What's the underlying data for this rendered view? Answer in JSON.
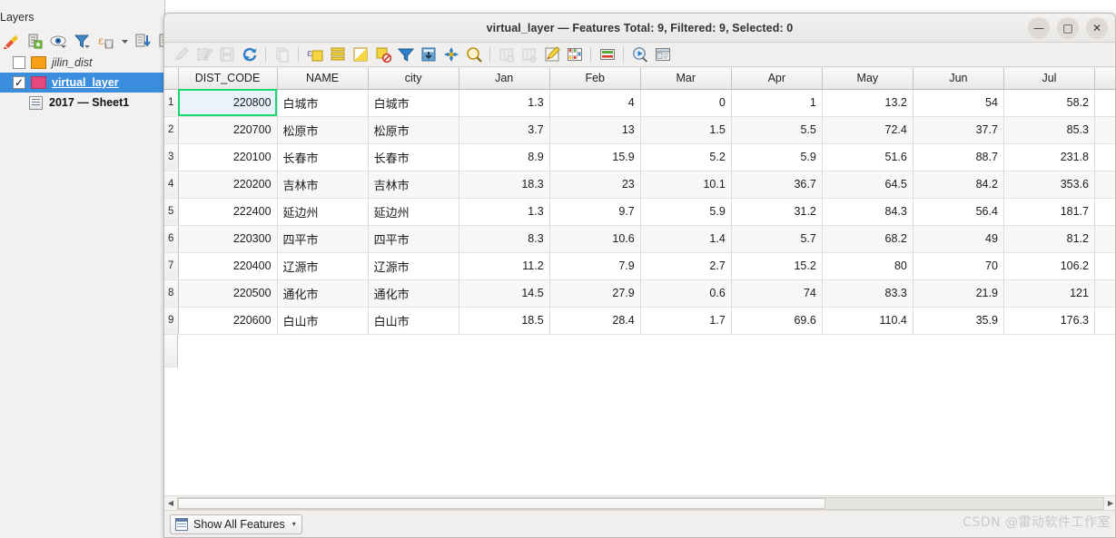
{
  "layers_panel": {
    "title": "Layers",
    "toolbar_icons": [
      "styling-brush-icon",
      "add-group-icon",
      "manage-visibility-icon",
      "filter-legend-icon",
      "expression-filter-icon",
      "filter-dropdown-caret-icon",
      "expand-all-icon",
      "collapse-all-icon"
    ],
    "items": [
      {
        "label": "jilin_dist",
        "checked": false,
        "swatch": "#f5a016",
        "kind": "polygon",
        "selected": false
      },
      {
        "label": "virtual_layer",
        "checked": true,
        "swatch": "#e5487f",
        "kind": "polygon",
        "selected": true
      },
      {
        "label": "2017 — Sheet1",
        "checked": null,
        "swatch": "",
        "kind": "table",
        "selected": false
      }
    ]
  },
  "window": {
    "title": "virtual_layer — Features Total: 9, Filtered: 9, Selected: 0",
    "controls": {
      "minimize": "—",
      "maximize": "□",
      "close": "✕"
    }
  },
  "toolbar": {
    "icons": [
      {
        "name": "toggle-editing-icon",
        "glyph": "pencil",
        "disabled": true
      },
      {
        "name": "multi-edit-icon",
        "glyph": "multiedit",
        "disabled": true
      },
      {
        "name": "save-edits-icon",
        "glyph": "save",
        "disabled": true
      },
      {
        "name": "reload-table-icon",
        "glyph": "reload",
        "disabled": false
      },
      {
        "name": "separator-1",
        "glyph": "sep",
        "disabled": false
      },
      {
        "name": "copy-features-icon",
        "glyph": "copyfeat",
        "disabled": true
      },
      {
        "name": "separator-2",
        "glyph": "sep",
        "disabled": false
      },
      {
        "name": "select-by-expression-icon",
        "glyph": "selectexpr",
        "disabled": false
      },
      {
        "name": "select-all-icon",
        "glyph": "selectall",
        "disabled": false
      },
      {
        "name": "invert-selection-icon",
        "glyph": "invertsel",
        "disabled": false
      },
      {
        "name": "deselect-all-icon",
        "glyph": "deselect",
        "disabled": false
      },
      {
        "name": "filter-selection-icon",
        "glyph": "funnel",
        "disabled": false
      },
      {
        "name": "move-selection-to-top-icon",
        "glyph": "movetop",
        "disabled": false
      },
      {
        "name": "pan-to-selection-icon",
        "glyph": "pansel",
        "disabled": false
      },
      {
        "name": "zoom-to-selection-icon",
        "glyph": "zoomsel",
        "disabled": false
      },
      {
        "name": "separator-3",
        "glyph": "sep",
        "disabled": false
      },
      {
        "name": "delete-field-icon",
        "glyph": "delfield",
        "disabled": true
      },
      {
        "name": "new-field-icon",
        "glyph": "newfield",
        "disabled": true
      },
      {
        "name": "open-field-calculator-icon",
        "glyph": "calcfield",
        "disabled": false
      },
      {
        "name": "conditional-formatting-icon",
        "glyph": "condfmt",
        "disabled": false
      },
      {
        "name": "separator-4",
        "glyph": "sep",
        "disabled": false
      },
      {
        "name": "organize-columns-icon",
        "glyph": "organize",
        "disabled": false
      },
      {
        "name": "separator-5",
        "glyph": "sep",
        "disabled": false
      },
      {
        "name": "actions-icon",
        "glyph": "action",
        "disabled": false
      },
      {
        "name": "attribute-form-icon",
        "glyph": "formview",
        "disabled": false
      }
    ]
  },
  "table": {
    "columns": [
      "DIST_CODE",
      "NAME",
      "city",
      "Jan",
      "Feb",
      "Mar",
      "Apr",
      "May",
      "Jun",
      "Jul",
      ""
    ],
    "rows": [
      {
        "n": "1",
        "cells": [
          "220800",
          "白城市",
          "白城市",
          "1.3",
          "4",
          "0",
          "1",
          "13.2",
          "54",
          "58.2"
        ],
        "selected_col": 0
      },
      {
        "n": "2",
        "cells": [
          "220700",
          "松原市",
          "松原市",
          "3.7",
          "13",
          "1.5",
          "5.5",
          "72.4",
          "37.7",
          "85.3"
        ],
        "selected_col": -1
      },
      {
        "n": "3",
        "cells": [
          "220100",
          "长春市",
          "长春市",
          "8.9",
          "15.9",
          "5.2",
          "5.9",
          "51.6",
          "88.7",
          "231.8"
        ],
        "selected_col": -1
      },
      {
        "n": "4",
        "cells": [
          "220200",
          "吉林市",
          "吉林市",
          "18.3",
          "23",
          "10.1",
          "36.7",
          "64.5",
          "84.2",
          "353.6"
        ],
        "selected_col": -1
      },
      {
        "n": "5",
        "cells": [
          "222400",
          "延边州",
          "延边州",
          "1.3",
          "9.7",
          "5.9",
          "31.2",
          "84.3",
          "56.4",
          "181.7"
        ],
        "selected_col": -1
      },
      {
        "n": "6",
        "cells": [
          "220300",
          "四平市",
          "四平市",
          "8.3",
          "10.6",
          "1.4",
          "5.7",
          "68.2",
          "49",
          "81.2"
        ],
        "selected_col": -1
      },
      {
        "n": "7",
        "cells": [
          "220400",
          "辽源市",
          "辽源市",
          "11.2",
          "7.9",
          "2.7",
          "15.2",
          "80",
          "70",
          "106.2"
        ],
        "selected_col": -1
      },
      {
        "n": "8",
        "cells": [
          "220500",
          "通化市",
          "通化市",
          "14.5",
          "27.9",
          "0.6",
          "74",
          "83.3",
          "21.9",
          "121"
        ],
        "selected_col": -1
      },
      {
        "n": "9",
        "cells": [
          "220600",
          "白山市",
          "白山市",
          "18.5",
          "28.4",
          "1.7",
          "69.6",
          "110.4",
          "35.9",
          "176.3"
        ],
        "selected_col": -1
      }
    ]
  },
  "bottom_bar": {
    "show_all_label": "Show All Features",
    "caret": "▾"
  },
  "watermark": "CSDN @雷动软件工作室",
  "colors": {
    "selection_outline": "#16d86e",
    "selected_cell_fill": "#eaf3fb",
    "layer_selected_bg": "#3b8ede",
    "jilin_dist_swatch": "#f5a016",
    "virtual_layer_swatch": "#e5487f"
  }
}
